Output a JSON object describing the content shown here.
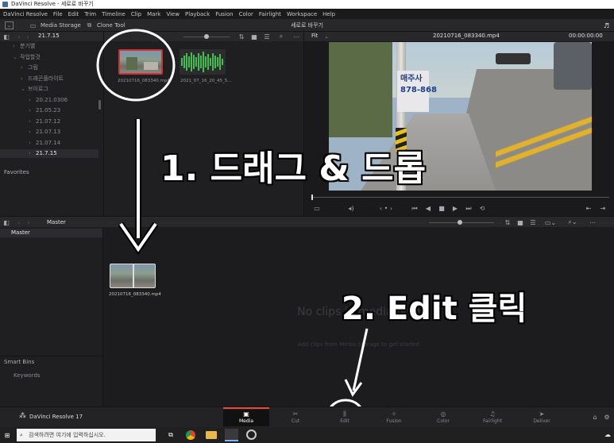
{
  "window_title": "DaVinci Resolve - 세로로 바꾸기",
  "menu": [
    "DaVinci Resolve",
    "File",
    "Edit",
    "Trim",
    "Timeline",
    "Clip",
    "Mark",
    "View",
    "Playback",
    "Fusion",
    "Color",
    "Fairlight",
    "Workspace",
    "Help"
  ],
  "toolbar": {
    "media_storage": "Media Storage",
    "clone_tool": "Clone Tool",
    "project_title": "세로로 바꾸기"
  },
  "storage_header": {
    "path": "21.7.15"
  },
  "folders": [
    {
      "label": "분기별",
      "indent": 1,
      "expanded": false,
      "selected": false
    },
    {
      "label": "작업할것",
      "indent": 1,
      "expanded": true,
      "selected": false
    },
    {
      "label": "그림",
      "indent": 2,
      "expanded": false,
      "selected": false
    },
    {
      "label": "드래곤플라이트",
      "indent": 2,
      "expanded": false,
      "selected": false
    },
    {
      "label": "브이로그",
      "indent": 2,
      "expanded": true,
      "selected": false
    },
    {
      "label": "20.21.0306",
      "indent": 3,
      "expanded": false,
      "selected": false
    },
    {
      "label": "21.05.23",
      "indent": 3,
      "expanded": false,
      "selected": false
    },
    {
      "label": "21.07.12",
      "indent": 3,
      "expanded": false,
      "selected": false
    },
    {
      "label": "21.07.13",
      "indent": 3,
      "expanded": false,
      "selected": false
    },
    {
      "label": "21.07.14",
      "indent": 3,
      "expanded": false,
      "selected": false
    },
    {
      "label": "21.7.15",
      "indent": 3,
      "expanded": false,
      "selected": true
    }
  ],
  "favorites_label": "Favorites",
  "storage_clips": [
    {
      "name": "20210716_083340.mp4",
      "kind": "video"
    },
    {
      "name": "2021_07_16_20_45_5...",
      "kind": "audio"
    }
  ],
  "viewer": {
    "zoom": "Fit",
    "clip_name": "20210716_083340.mp4",
    "timecode": "00:00:00:00",
    "street_sign": "매주사\n878-868"
  },
  "media_pool": {
    "title": "Master",
    "bin_master": "Master",
    "smart_bins": "Smart Bins",
    "keywords": "Keywords",
    "clip_name": "20210716_083340.mp4",
    "empty_title": "No clips in media pool",
    "empty_hint": "Add clips from Media Storage to get started"
  },
  "annotations": {
    "step1": "1. 드래그 & 드롭",
    "step2": "2. Edit 클릭"
  },
  "brand": "DaVinci Resolve 17",
  "pages": [
    {
      "label": "Media",
      "icon": "▣",
      "active": true
    },
    {
      "label": "Cut",
      "icon": "✂",
      "active": false
    },
    {
      "label": "Edit",
      "icon": "⫼",
      "active": false
    },
    {
      "label": "Fusion",
      "icon": "✧",
      "active": false
    },
    {
      "label": "Color",
      "icon": "◎",
      "active": false
    },
    {
      "label": "Fairlight",
      "icon": "♫",
      "active": false
    },
    {
      "label": "Deliver",
      "icon": "➤",
      "active": false
    }
  ],
  "taskbar": {
    "search_placeholder": "검색하려면 여기에 입력하십시오."
  },
  "colors": {
    "accent_red": "#e24b3b",
    "panel_bg": "#1f1f22",
    "header_bg": "#28282b"
  }
}
